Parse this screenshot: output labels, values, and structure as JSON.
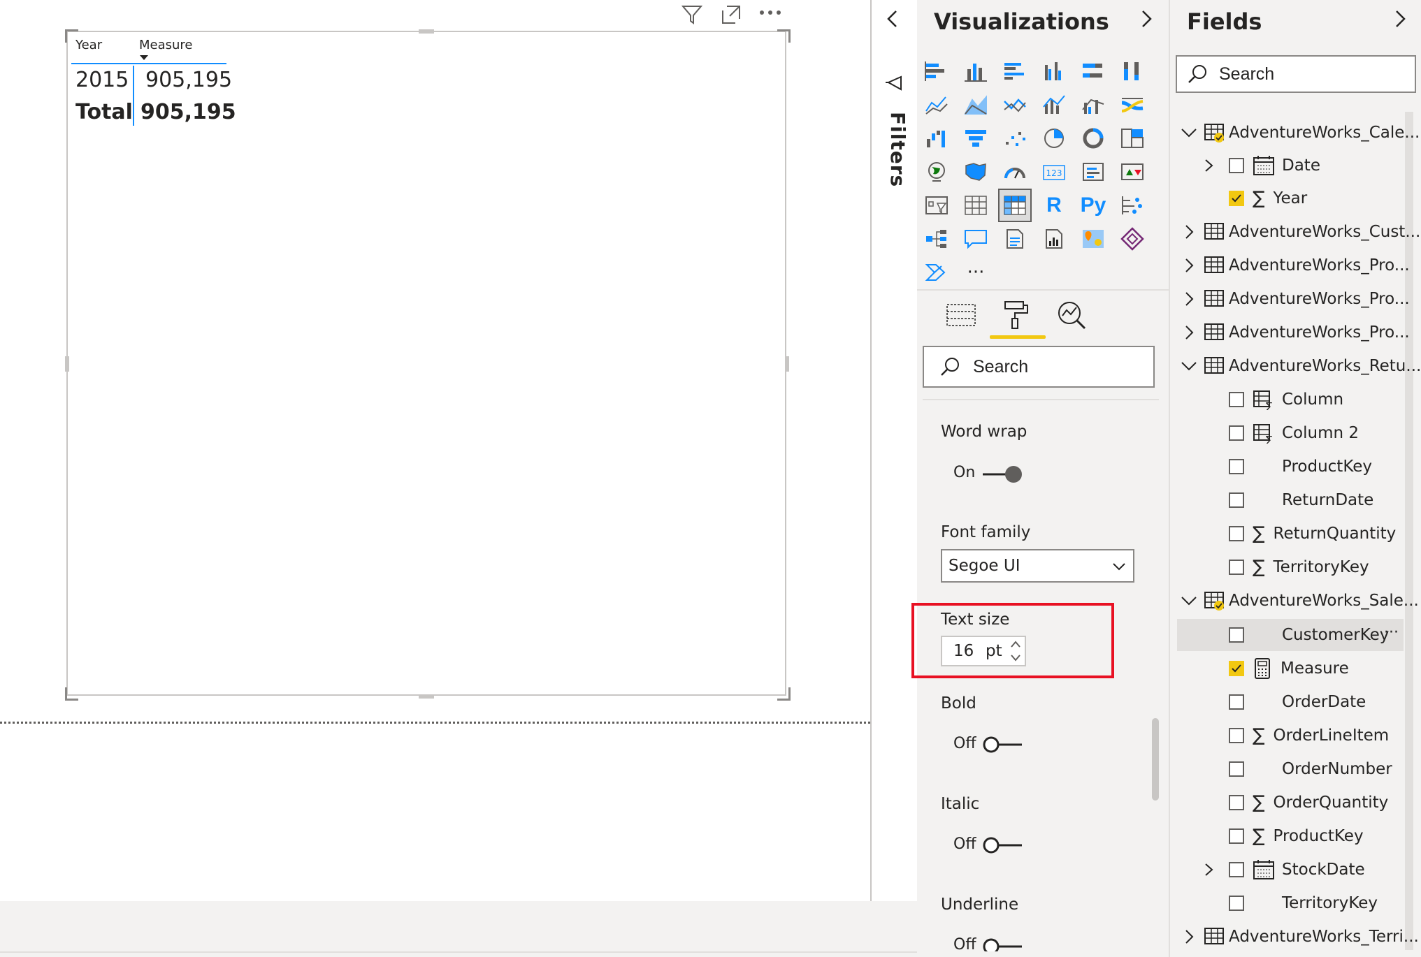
{
  "table_visual": {
    "headers": [
      "Year",
      "Measure"
    ],
    "rows": [
      {
        "year": "2015",
        "measure": "905,195"
      }
    ],
    "total": {
      "label": "Total",
      "measure": "905,195"
    }
  },
  "filters_pane": {
    "label": "Filters"
  },
  "visualizations_pane": {
    "title": "Visualizations",
    "search_placeholder": "Search",
    "format": {
      "word_wrap": {
        "label": "Word wrap",
        "state": "On"
      },
      "font_family": {
        "label": "Font family",
        "value": "Segoe UI"
      },
      "text_size": {
        "label": "Text size",
        "value": "16",
        "unit": "pt"
      },
      "bold": {
        "label": "Bold",
        "state": "Off"
      },
      "italic": {
        "label": "Italic",
        "state": "Off"
      },
      "underline": {
        "label": "Underline",
        "state": "Off"
      }
    }
  },
  "fields_pane": {
    "title": "Fields",
    "search_placeholder": "Search",
    "tables": [
      {
        "name": "AdventureWorks_Cale..."
      },
      {
        "name": "AdventureWorks_Cust..."
      },
      {
        "name": "AdventureWorks_Pro..."
      },
      {
        "name": "AdventureWorks_Pro..."
      },
      {
        "name": "AdventureWorks_Pro..."
      },
      {
        "name": "AdventureWorks_Retu..."
      },
      {
        "name": "AdventureWorks_Sale..."
      },
      {
        "name": "AdventureWorks_Terri..."
      }
    ],
    "fields": {
      "cal_date": "Date",
      "cal_year": "Year",
      "ret_column": "Column",
      "ret_column2": "Column 2",
      "ret_productkey": "ProductKey",
      "ret_returndate": "ReturnDate",
      "ret_returnquantity": "ReturnQuantity",
      "ret_territorykey": "TerritoryKey",
      "sal_customerkey": "CustomerKey",
      "sal_measure": "Measure",
      "sal_orderdate": "OrderDate",
      "sal_orderlineitem": "OrderLineItem",
      "sal_ordernumber": "OrderNumber",
      "sal_orderquantity": "OrderQuantity",
      "sal_productkey": "ProductKey",
      "sal_stockdate": "StockDate",
      "sal_territorykey": "TerritoryKey"
    },
    "more_options": "···"
  },
  "more_visuals": "···",
  "colors": {
    "accent_yellow": "#f2c811",
    "highlight_red": "#e81123",
    "pane_bg": "#f3f2f1",
    "icon_blue": "#118dff"
  }
}
